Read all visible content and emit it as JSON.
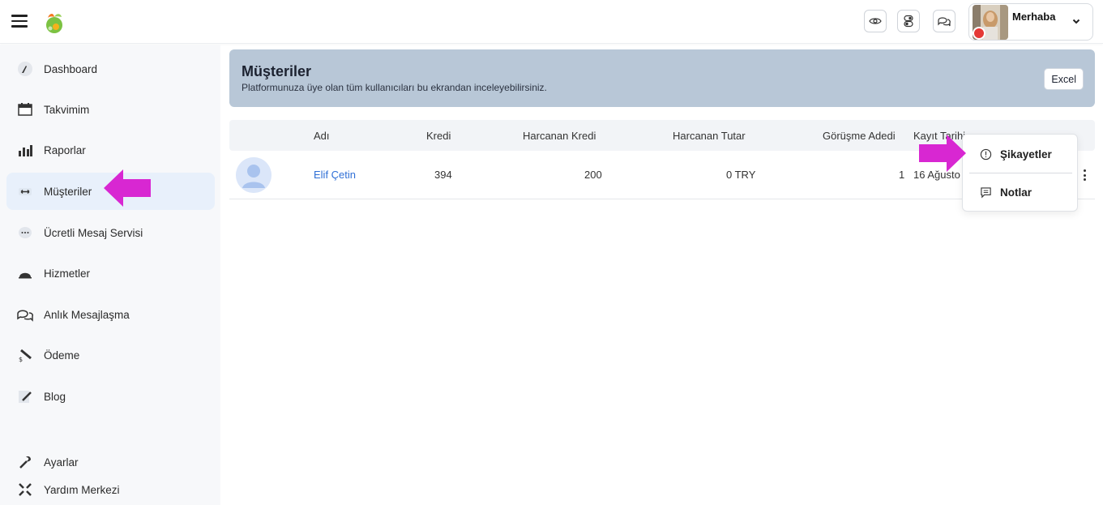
{
  "header": {
    "greeting": "Merhaba",
    "icons": [
      "eye-icon",
      "toggle-icon",
      "chat-icon"
    ]
  },
  "sidebar": {
    "items": [
      {
        "label": "Dashboard",
        "icon": "dashboard-icon"
      },
      {
        "label": "Takvimim",
        "icon": "calendar-icon"
      },
      {
        "label": "Raporlar",
        "icon": "bar-chart-icon"
      },
      {
        "label": "Müşteriler",
        "icon": "customers-icon",
        "active": true
      },
      {
        "label": "Ücretli Mesaj Servisi",
        "icon": "message-bubble-icon"
      },
      {
        "label": "Hizmetler",
        "icon": "services-icon"
      },
      {
        "label": "Anlık Mesajlaşma",
        "icon": "chat-icon"
      },
      {
        "label": "Ödeme",
        "icon": "payment-icon"
      },
      {
        "label": "Blog",
        "icon": "blog-icon"
      },
      {
        "label": "Ayarlar",
        "icon": "wrench-icon"
      },
      {
        "label": "Yardım Merkezi",
        "icon": "help-icon"
      }
    ]
  },
  "page": {
    "title": "Müşteriler",
    "subtitle": "Platformunuza üye olan tüm kullanıcıları bu ekrandan inceleyebilirsiniz.",
    "excel_label": "Excel"
  },
  "table": {
    "columns": [
      "Adı",
      "Kredi",
      "Harcanan Kredi",
      "Harcanan Tutar",
      "Görüşme Adedi",
      "Kayıt Tarihi"
    ],
    "rows": [
      {
        "name": "Elif Çetin",
        "kredi": "394",
        "harcanan_kredi": "200",
        "harcanan_tutar": "0 TRY",
        "gorusme_adedi": "1",
        "kayit_tarihi": "16 Ağusto"
      }
    ]
  },
  "dropdown": {
    "items": [
      {
        "label": "Şikayetler",
        "icon": "alert-circle-icon"
      },
      {
        "label": "Notlar",
        "icon": "note-icon"
      }
    ]
  },
  "colors": {
    "accent_arrow": "#d827d2",
    "banner_bg": "#b8c7d7",
    "link": "#2f6fd6",
    "active_bg": "#e8f0fb"
  }
}
